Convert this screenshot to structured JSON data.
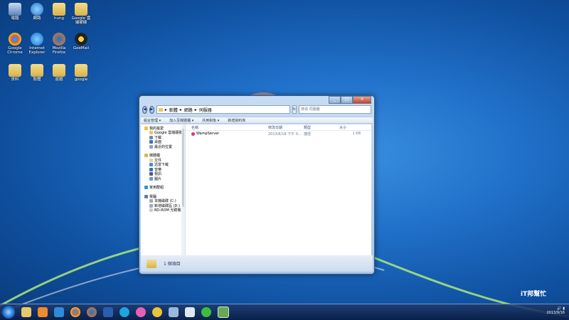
{
  "desktop_icons": [
    {
      "label": "電腦",
      "type": "computer"
    },
    {
      "label": "網路",
      "type": "network"
    },
    {
      "label": "hung",
      "type": "folder"
    },
    {
      "label": "Google 雲端硬碟",
      "type": "gdrive"
    },
    {
      "label": "Google Chrome",
      "type": "chrome"
    },
    {
      "label": "Internet Explorer",
      "type": "ie"
    },
    {
      "label": "Mozilla Firefox",
      "type": "firefox"
    },
    {
      "label": "GeeMail",
      "type": "geemail"
    },
    {
      "label": "資料",
      "type": "folder"
    },
    {
      "label": "軟體",
      "type": "folder"
    },
    {
      "label": "遊戲",
      "type": "folder"
    },
    {
      "label": "google",
      "type": "folder"
    }
  ],
  "window": {
    "path": [
      "軟體",
      "網路",
      "伺服器"
    ],
    "search_placeholder": "搜尋 伺服器",
    "toolbar": [
      "組合管理 ▾",
      "加入至媒體櫃 ▾",
      "共用對象 ▾",
      "新增資料夾"
    ],
    "favorites_header": "我的最愛",
    "favorites": [
      "Google 雲端硬碟",
      "下載",
      "桌面",
      "最近的位置"
    ],
    "library_header": "媒體櫃",
    "libraries": [
      "文件",
      "迅雷下載",
      "音樂",
      "視訊",
      "圖片"
    ],
    "homegroup": "家用群組",
    "computer_header": "電腦",
    "drives": [
      "本機磁碟 (C:)",
      "新增磁碟區 (D:)",
      "BD-ROM 光碟機"
    ],
    "columns": [
      "名稱",
      "修改日期",
      "類型",
      "大小"
    ],
    "files": [
      {
        "name": "WampServer",
        "date": "2013/6/18 下午 0...",
        "type": "捷徑",
        "size": "1 KB"
      }
    ],
    "status": "1 個項目"
  },
  "taskbar": {
    "time": "",
    "date": "2013/9/16"
  },
  "watermark": "iT邦幫忙",
  "colors": {
    "accent": "#1f6fc8",
    "window_frame": "#a9c6e6"
  }
}
